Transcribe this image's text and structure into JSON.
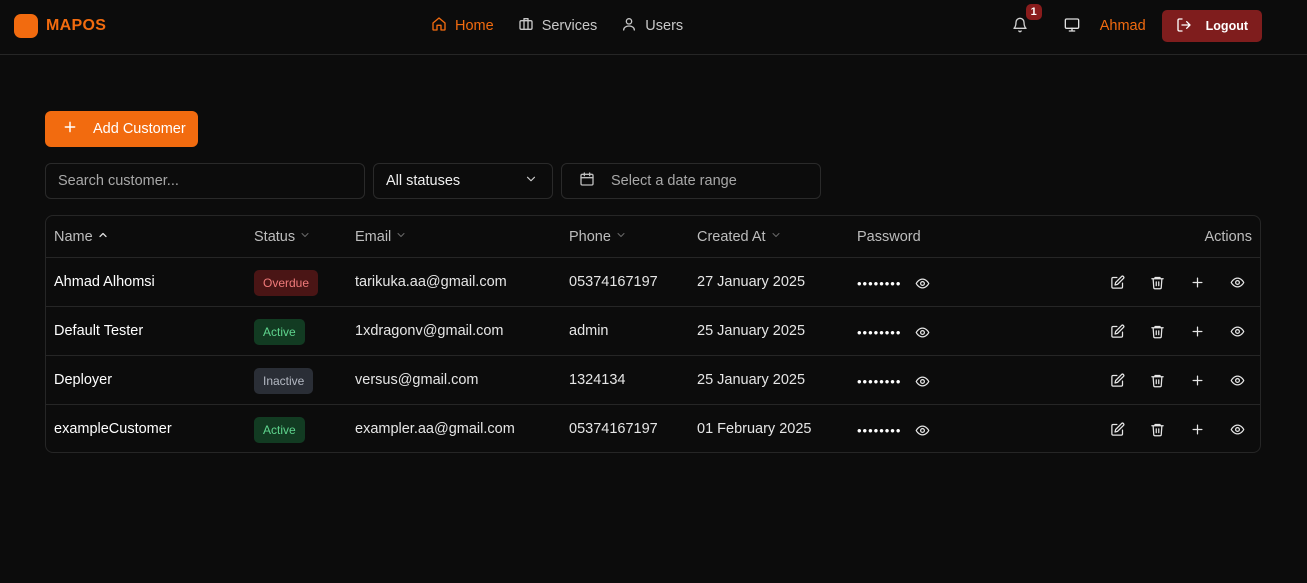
{
  "brand": {
    "name": "MAPOS"
  },
  "nav": [
    {
      "label": "Home",
      "icon": "home-icon",
      "active": true
    },
    {
      "label": "Services",
      "icon": "briefcase-icon",
      "active": false
    },
    {
      "label": "Users",
      "icon": "user-icon",
      "active": false
    }
  ],
  "header": {
    "notification_count": "1",
    "user_name": "Ahmad",
    "logout_label": "Logout"
  },
  "toolbar": {
    "add_label": "Add Customer",
    "search_placeholder": "Search customer...",
    "status_value": "All statuses",
    "date_placeholder": "Select a date range"
  },
  "table": {
    "columns": {
      "name": "Name",
      "status": "Status",
      "email": "Email",
      "phone": "Phone",
      "created": "Created At",
      "password": "Password",
      "actions": "Actions"
    },
    "rows": [
      {
        "name": "Ahmad Alhomsi",
        "status": "Overdue",
        "status_kind": "overdue",
        "email": "tarikuka.aa@gmail.com",
        "phone": "05374167197",
        "created": "27 January 2025",
        "password": "••••••••"
      },
      {
        "name": "Default Tester",
        "status": "Active",
        "status_kind": "active",
        "email": "1xdragonv@gmail.com",
        "phone": "admin",
        "created": "25 January 2025",
        "password": "••••••••"
      },
      {
        "name": "Deployer",
        "status": "Inactive",
        "status_kind": "inactive",
        "email": "versus@gmail.com",
        "phone": "1324134",
        "created": "25 January 2025",
        "password": "••••••••"
      },
      {
        "name": "exampleCustomer",
        "status": "Active",
        "status_kind": "active",
        "email": "exampler.aa@gmail.com",
        "phone": "05374167197",
        "created": "01 February 2025",
        "password": "••••••••"
      }
    ]
  },
  "colors": {
    "accent": "#f26b0f",
    "logout_bg": "#7f1d1d",
    "background": "#0c0c0c"
  }
}
